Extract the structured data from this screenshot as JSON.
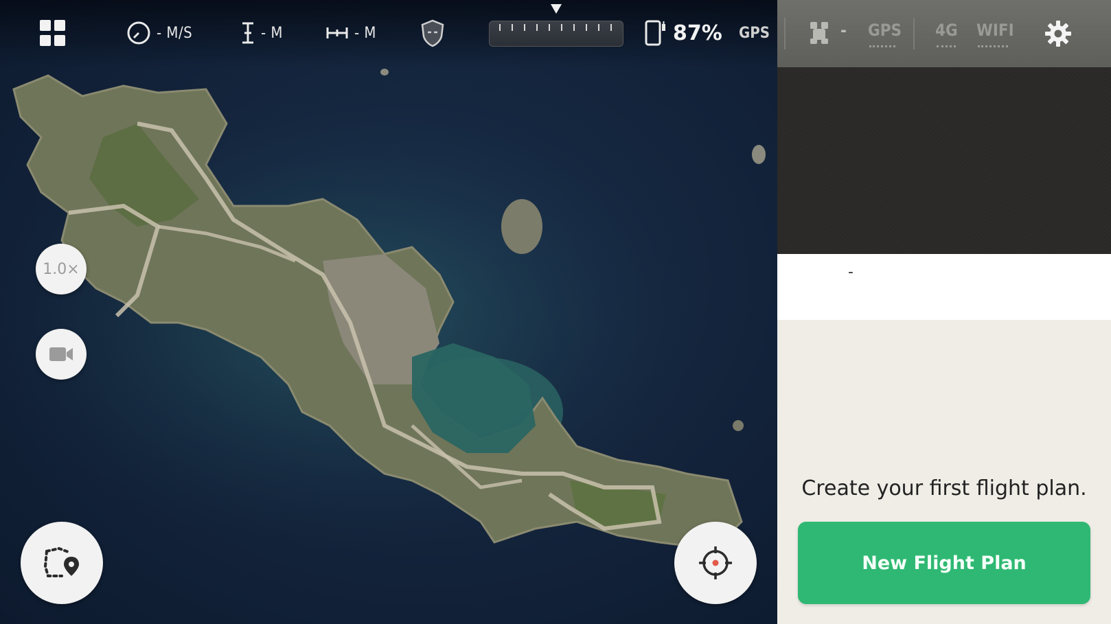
{
  "topbar": {
    "speed": "- M/S",
    "altitude": "- M",
    "distance": "- M",
    "battery": "87%",
    "gps": "GPS"
  },
  "status_panel": {
    "drone_value": "-",
    "gps": "GPS",
    "cell": "4G",
    "wifi": "WIFI"
  },
  "info": {
    "value": "-"
  },
  "map": {
    "zoom_label": "1.0×"
  },
  "flight_plan": {
    "prompt": "Create your first flight plan.",
    "button_label": "New Flight Plan"
  },
  "icons": {
    "menu": "grid-icon",
    "speed": "speedometer-icon",
    "altitude": "altitude-icon",
    "distance": "distance-icon",
    "geofence": "shield-icon",
    "phone_battery": "phone-battery-icon",
    "drone": "drone-icon",
    "settings": "gear-icon",
    "camera": "video-camera-icon",
    "flight_plan": "route-pin-icon",
    "locate": "crosshair-icon"
  },
  "colors": {
    "accent": "#2fb873",
    "panel_bg": "#efede6"
  }
}
